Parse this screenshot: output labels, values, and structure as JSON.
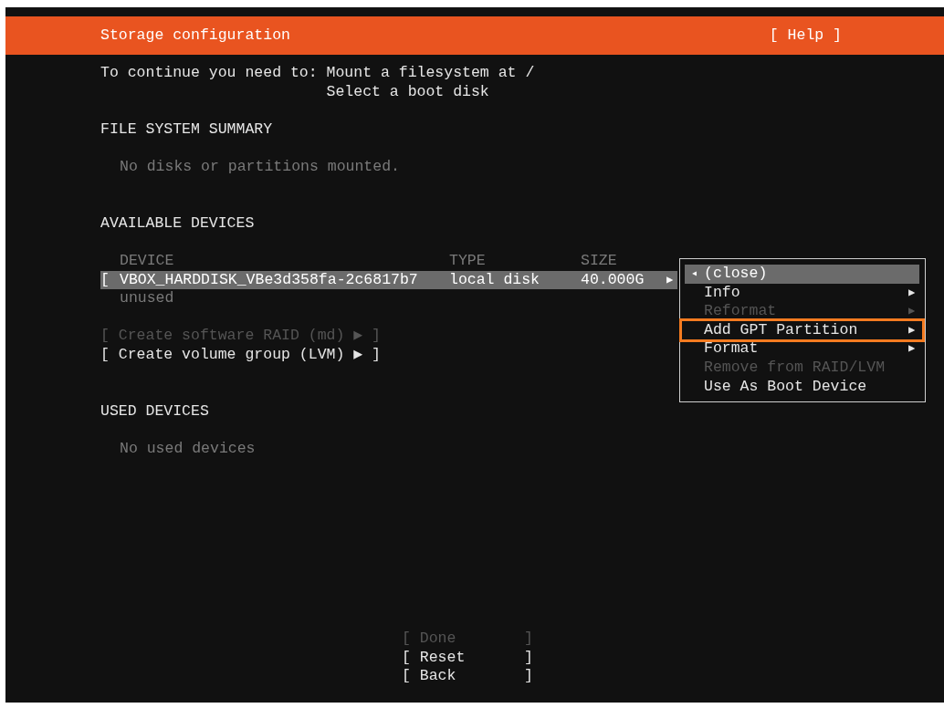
{
  "header": {
    "title": "Storage configuration",
    "help": "[ Help ]"
  },
  "requirements": {
    "label": "To continue you need to:",
    "items": [
      "Mount a filesystem at /",
      "Select a boot disk"
    ]
  },
  "file_system_summary": {
    "heading": "FILE SYSTEM SUMMARY",
    "empty": "No disks or partitions mounted."
  },
  "available_devices": {
    "heading": "AVAILABLE DEVICES",
    "columns": [
      "DEVICE",
      "TYPE",
      "SIZE"
    ],
    "devices": [
      {
        "bracket": "[",
        "name": "VBOX_HARDDISK_VBe3d358fa-2c6817b7",
        "type": "local disk",
        "size": "40.000G",
        "arrow": "▶",
        "status": "unused",
        "selected": true
      }
    ],
    "actions": [
      {
        "label": "[ Create software RAID (md) ▶ ]",
        "disabled": true
      },
      {
        "label": "[ Create volume group (LVM) ▶ ]",
        "disabled": false
      }
    ]
  },
  "used_devices": {
    "heading": "USED DEVICES",
    "empty": "No used devices"
  },
  "menu": {
    "items": [
      {
        "kind": "back",
        "arrow": "◂",
        "label": "(close)",
        "selected": true,
        "disabled": false,
        "highlighted": false
      },
      {
        "kind": "submenu",
        "arrow": "▶",
        "label": "Info",
        "selected": false,
        "disabled": false,
        "highlighted": false
      },
      {
        "kind": "submenu",
        "arrow": "▶",
        "label": "Reformat",
        "selected": false,
        "disabled": true,
        "highlighted": false
      },
      {
        "kind": "submenu",
        "arrow": "▶",
        "label": "Add GPT Partition",
        "selected": false,
        "disabled": false,
        "highlighted": true
      },
      {
        "kind": "submenu",
        "arrow": "▶",
        "label": "Format",
        "selected": false,
        "disabled": false,
        "highlighted": false
      },
      {
        "kind": "action",
        "label": "Remove from RAID/LVM",
        "selected": false,
        "disabled": true,
        "highlighted": false
      },
      {
        "kind": "action",
        "label": "Use As Boot Device",
        "selected": false,
        "disabled": false,
        "highlighted": false
      }
    ]
  },
  "buttons": [
    {
      "open": "[",
      "label": "Done",
      "close": "]",
      "disabled": true
    },
    {
      "open": "[",
      "label": "Reset",
      "close": "]",
      "disabled": false
    },
    {
      "open": "[",
      "label": "Back",
      "close": "]",
      "disabled": false
    }
  ]
}
